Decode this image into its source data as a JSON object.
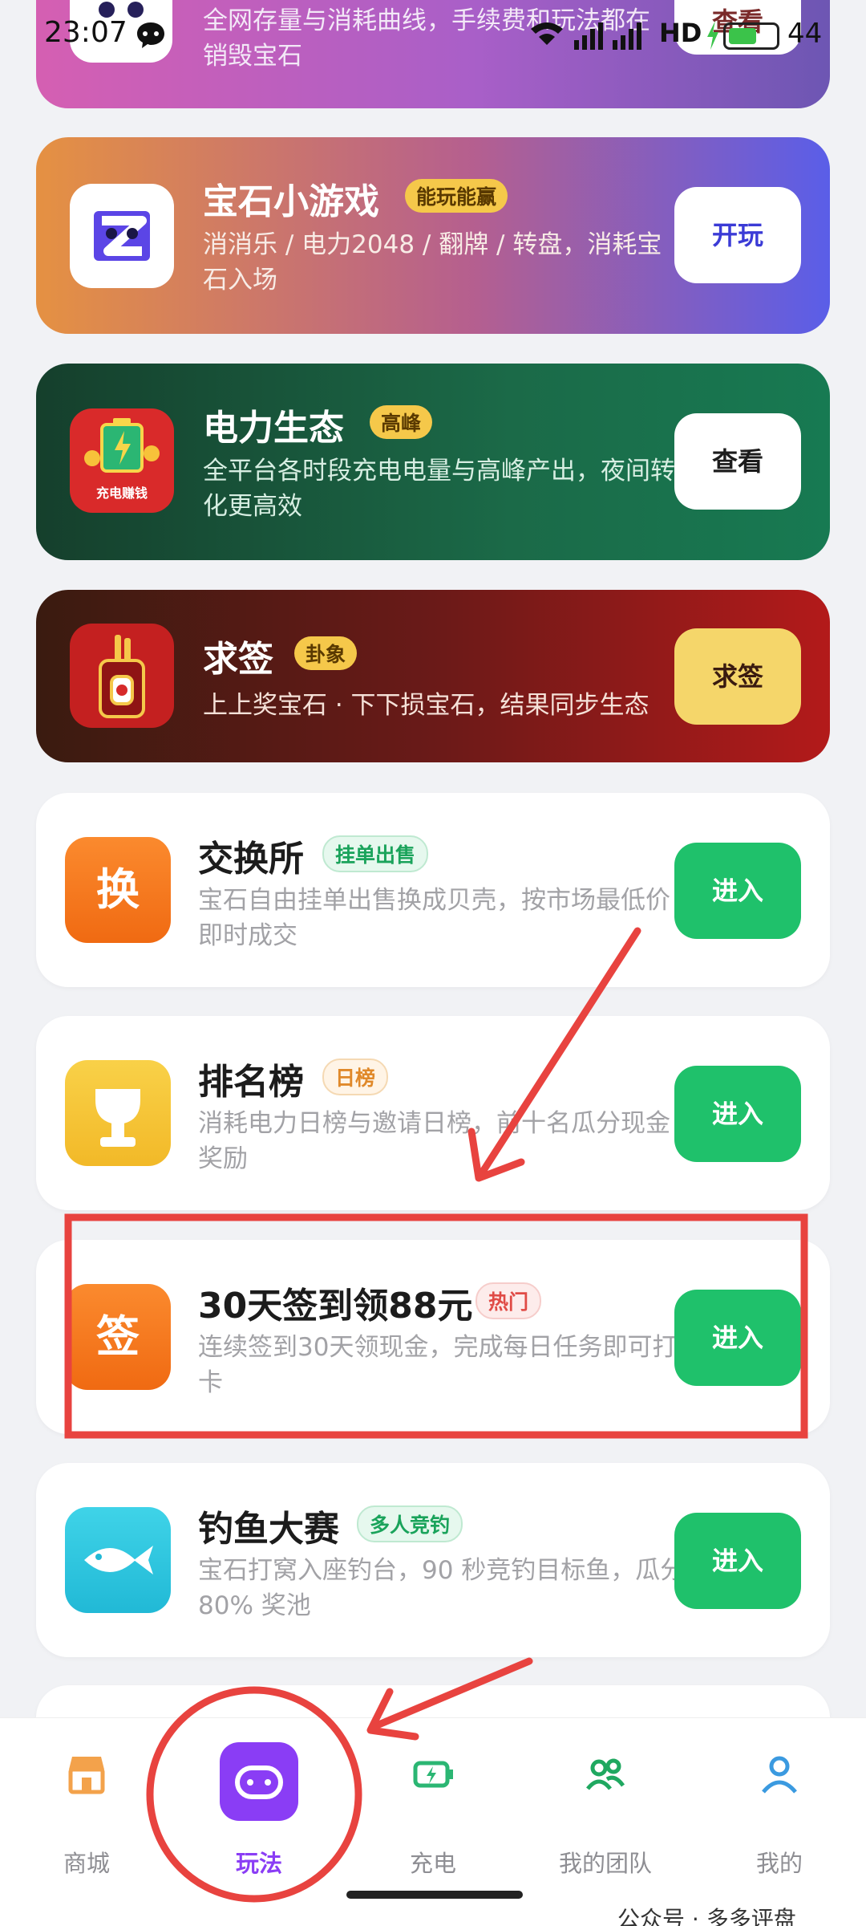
{
  "status_bar": {
    "time": "23:07",
    "network": "HD",
    "battery": "44"
  },
  "cards": [
    {
      "desc": "全网存量与消耗曲线，手续费和玩法都在销毁宝石",
      "button": "查看"
    },
    {
      "title": "宝石小游戏",
      "tag": "能玩能赢",
      "desc": "消消乐 / 电力2048 / 翻牌 / 转盘，消耗宝石入场",
      "button": "开玩"
    },
    {
      "title": "电力生态",
      "tag": "高峰",
      "desc": "全平台各时段充电电量与高峰产出，夜间转化更高效",
      "button": "查看",
      "icon_text": "充电赚钱"
    },
    {
      "title": "求签",
      "tag": "卦象",
      "desc": "上上奖宝石 · 下下损宝石，结果同步生态",
      "button": "求签"
    },
    {
      "title": "交换所",
      "tag": "挂单出售",
      "desc": "宝石自由挂单出售换成贝壳，按市场最低价即时成交",
      "button": "进入",
      "icon_text": "换"
    },
    {
      "title": "排名榜",
      "tag": "日榜",
      "desc": "消耗电力日榜与邀请日榜，前十名瓜分现金奖励",
      "button": "进入"
    },
    {
      "title": "30天签到领88元",
      "tag": "热门",
      "desc": "连续签到30天领现金，完成每日任务即可打卡",
      "button": "进入",
      "icon_text": "签"
    },
    {
      "title": "钓鱼大赛",
      "tag": "多人竞钓",
      "desc": "宝石打窝入座钓台，90 秒竞钓目标鱼，瓜分 80% 奖池",
      "button": "进入"
    }
  ],
  "nav": [
    {
      "label": "商城",
      "icon": "store-icon"
    },
    {
      "label": "玩法",
      "icon": "gamepad-icon"
    },
    {
      "label": "充电",
      "icon": "battery-charge-icon"
    },
    {
      "label": "我的团队",
      "icon": "team-icon"
    },
    {
      "label": "我的",
      "icon": "user-icon"
    }
  ],
  "watermark": "公众号 · 多多评盘",
  "colors": {
    "brand_purple": "#8a3df5",
    "green_button": "#1fc16b",
    "annotation_red": "#e8433f",
    "tag_gold": "#f5c84a"
  }
}
